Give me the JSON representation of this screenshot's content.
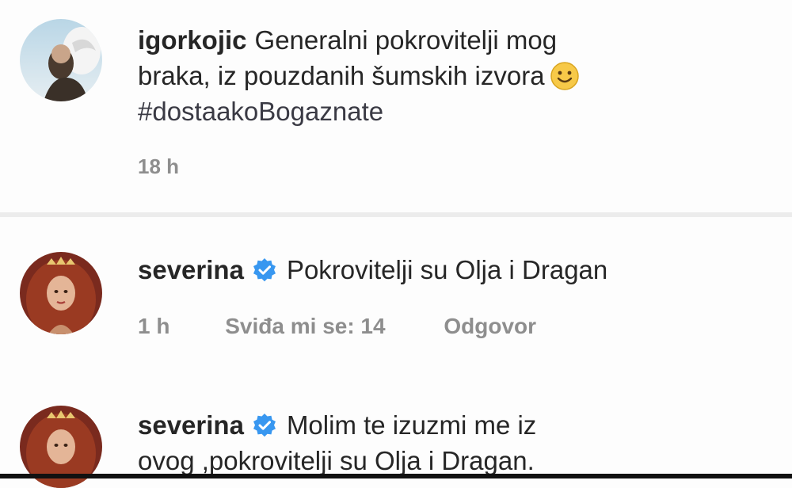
{
  "post": {
    "username": "igorkojic",
    "line1": "Generalni pokrovitelji mog",
    "line2": "braka, iz pouzdanih šumskih izvora",
    "hashtag": "#dostaakoBogaznate",
    "time": "18 h",
    "emoji_icon": "smiling-face-emoji"
  },
  "comments": [
    {
      "username": "severina",
      "verified": true,
      "text": "Pokrovitelji su Olja i Dragan",
      "time": "1 h",
      "likes_label": "Sviđa mi se: 14",
      "reply_label": "Odgovor"
    },
    {
      "username": "severina",
      "verified": true,
      "text_line1": "Molim te izuzmi me iz",
      "text_line2": "ovog ,pokrovitelji su Olja i Dragan."
    }
  ],
  "colors": {
    "verified_badge": "#3897f0",
    "meta_text": "#8e8e8e",
    "primary_text": "#262626"
  }
}
